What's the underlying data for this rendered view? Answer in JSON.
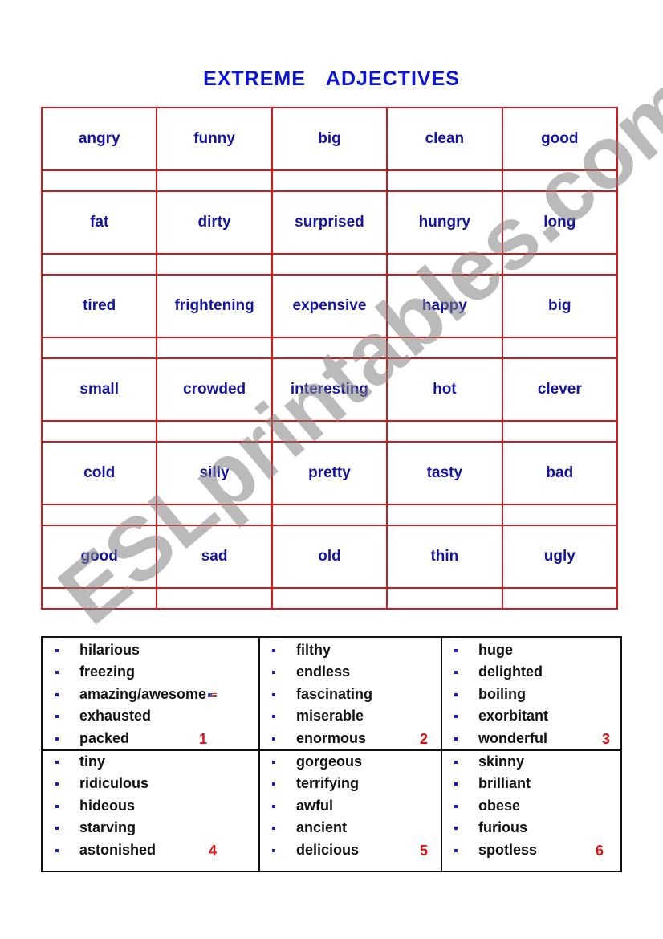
{
  "title": "EXTREME   ADJECTIVES",
  "grid": {
    "rows": [
      [
        "angry",
        "funny",
        "big",
        "clean",
        "good"
      ],
      [
        "fat",
        "dirty",
        "surprised",
        "hungry",
        "long"
      ],
      [
        "tired",
        "frightening",
        "expensive",
        "happy",
        "big"
      ],
      [
        "small",
        "crowded",
        "interesting",
        "hot",
        "clever"
      ],
      [
        "cold",
        "silly",
        "pretty",
        "tasty",
        "bad"
      ],
      [
        "good",
        "sad",
        "old",
        "thin",
        "ugly"
      ]
    ]
  },
  "answer_groups": [
    {
      "number": "1",
      "words": [
        "hilarious",
        "freezing",
        "amazing/awesome",
        "exhausted",
        "packed"
      ],
      "flag_icon_on": "amazing/awesome"
    },
    {
      "number": "2",
      "words": [
        "filthy",
        "endless",
        "fascinating",
        "miserable",
        "enormous"
      ]
    },
    {
      "number": "3",
      "words": [
        "huge",
        "delighted",
        "boiling",
        "exorbitant",
        "wonderful"
      ]
    },
    {
      "number": "4",
      "words": [
        "tiny",
        "ridiculous",
        "hideous",
        "starving",
        "astonished"
      ]
    },
    {
      "number": "5",
      "words": [
        "gorgeous",
        "terrifying",
        "awful",
        "ancient",
        "delicious"
      ]
    },
    {
      "number": "6",
      "words": [
        "skinny",
        "brilliant",
        "obese",
        "furious",
        "spotless"
      ]
    }
  ],
  "watermark": "ESLprintables.com",
  "colors": {
    "title": "#0a14d8",
    "grid_border": "#d21a1a",
    "grid_text": "#1414a0",
    "answer_text": "#111111",
    "number": "#e01010",
    "bullet": "#1a1ad0"
  }
}
